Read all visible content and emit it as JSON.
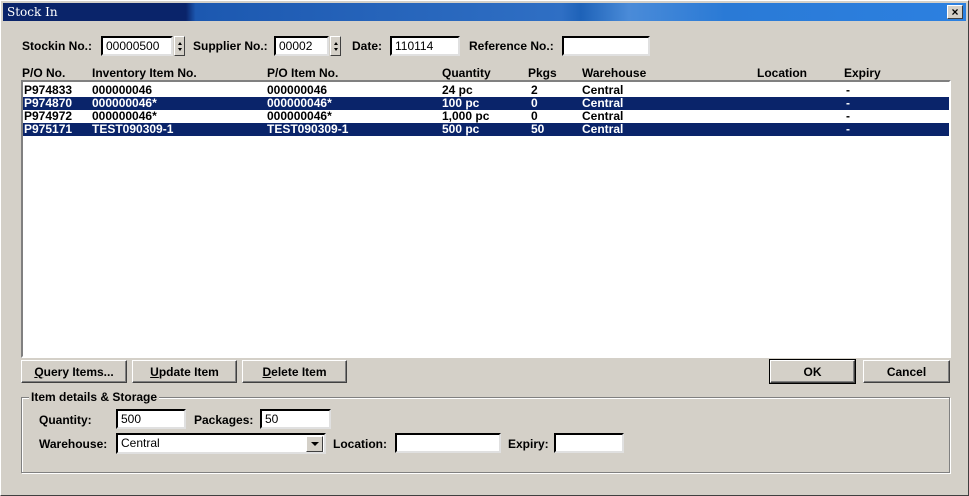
{
  "window": {
    "title": "Stock In",
    "close_glyph": "×"
  },
  "header": {
    "stockin_label": "Stockin No.:",
    "stockin_value": "00000500",
    "supplier_label": "Supplier No.:",
    "supplier_value": "00002",
    "date_label": "Date:",
    "date_value": "110114",
    "reference_label": "Reference No.:",
    "reference_value": ""
  },
  "table": {
    "columns": [
      "P/O No.",
      "Inventory Item No.",
      "P/O Item No.",
      "Quantity",
      "Pkgs",
      "Warehouse",
      "Location",
      "Expiry"
    ],
    "rows": [
      {
        "po": "P974833",
        "inv": "000000046",
        "poitem": "000000046",
        "qty": "24 pc",
        "pkgs": "2",
        "wh": "Central",
        "loc": "",
        "exp": "-",
        "selected": false
      },
      {
        "po": "P974870",
        "inv": "000000046*",
        "poitem": "000000046*",
        "qty": "100 pc",
        "pkgs": "0",
        "wh": "Central",
        "loc": "",
        "exp": "-",
        "selected": true
      },
      {
        "po": "P974972",
        "inv": "000000046*",
        "poitem": "000000046*",
        "qty": "1,000 pc",
        "pkgs": "0",
        "wh": "Central",
        "loc": "",
        "exp": "-",
        "selected": false
      },
      {
        "po": "P975171",
        "inv": "TEST090309-1",
        "poitem": "TEST090309-1",
        "qty": "500 pc",
        "pkgs": "50",
        "wh": "Central",
        "loc": "",
        "exp": "-",
        "selected": true
      }
    ]
  },
  "buttons": {
    "query_first": "Q",
    "query_rest": "uery Items...",
    "update_first": "U",
    "update_rest": "pdate Item",
    "delete_first": "D",
    "delete_rest": "elete Item",
    "ok": "OK",
    "cancel": "Cancel"
  },
  "details": {
    "group_title": "Item details & Storage",
    "quantity_label": "Quantity:",
    "quantity_value": "500",
    "packages_label": "Packages:",
    "packages_value": "50",
    "warehouse_label": "Warehouse:",
    "warehouse_value": "Central",
    "location_label": "Location:",
    "location_value": "",
    "expiry_label": "Expiry:",
    "expiry_value": ""
  },
  "colors": {
    "selection": "#0a246a",
    "face": "#d4d0c8"
  },
  "icons": {
    "spin": "spinner-arrows-icon",
    "combo": "chevron-down-icon",
    "close": "close-icon"
  }
}
